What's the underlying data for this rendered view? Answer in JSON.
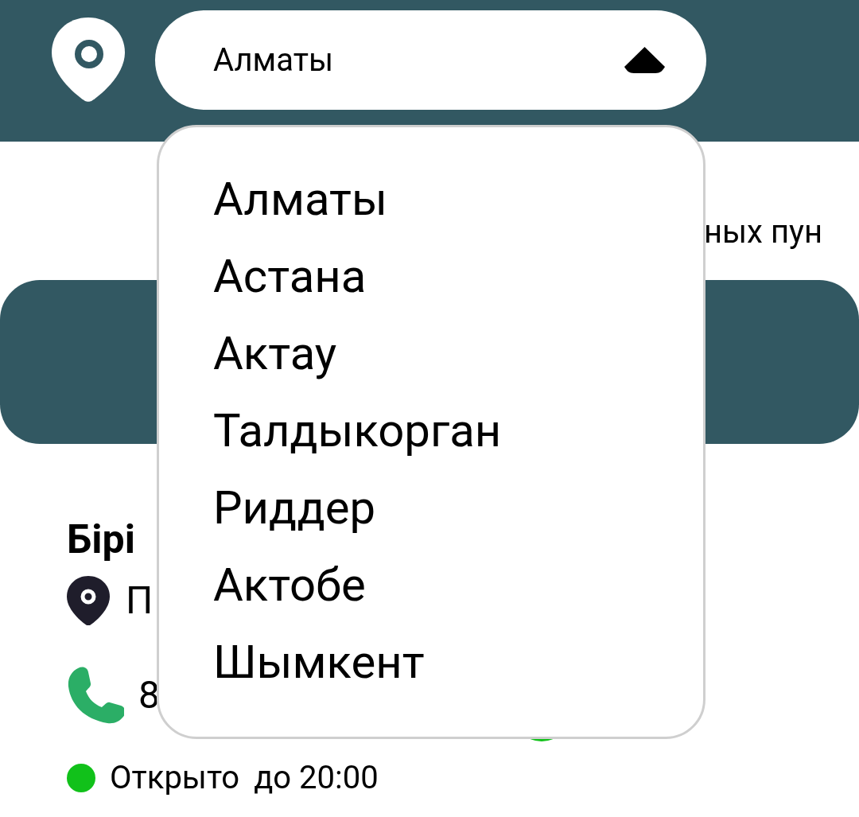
{
  "header": {
    "city_select": {
      "value": "Алматы",
      "expanded": true
    }
  },
  "dropdown": {
    "options": [
      "Алматы",
      "Астана",
      "Актау",
      "Талдыкорган",
      "Риддер",
      "Актобе",
      "Шымкент"
    ]
  },
  "content": {
    "subtitle_fragment": "ных пун",
    "point": {
      "name": "Бірі",
      "address": "П",
      "phone": "8",
      "open": true,
      "status": "Открыто",
      "hours": "до 20:00"
    }
  }
}
